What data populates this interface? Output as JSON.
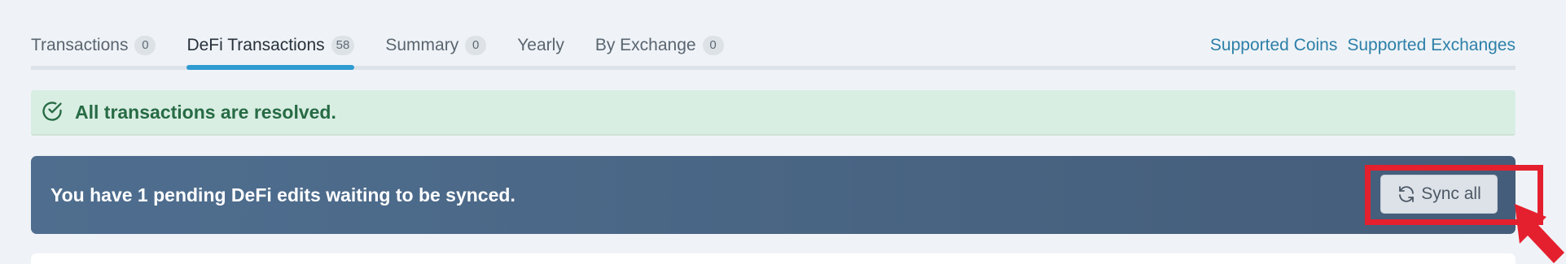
{
  "tabs": [
    {
      "label": "Transactions",
      "count": "0"
    },
    {
      "label": "DeFi Transactions",
      "count": "58",
      "active": true
    },
    {
      "label": "Summary",
      "count": "0"
    },
    {
      "label": "Yearly"
    },
    {
      "label": "By Exchange",
      "count": "0"
    }
  ],
  "links": {
    "supported_coins": "Supported Coins",
    "supported_exchanges": "Supported Exchanges"
  },
  "alert": {
    "text": "All transactions are resolved.",
    "icon": "check-circle-icon"
  },
  "pending": {
    "text": "You have 1 pending DeFi edits waiting to be synced.",
    "button_label": "Sync all",
    "button_icon": "sync-icon"
  },
  "colors": {
    "accent": "#2f9bd1",
    "highlight": "#e5202e",
    "success_bg": "#d9eee3",
    "banner_bg": "#4a6686"
  }
}
